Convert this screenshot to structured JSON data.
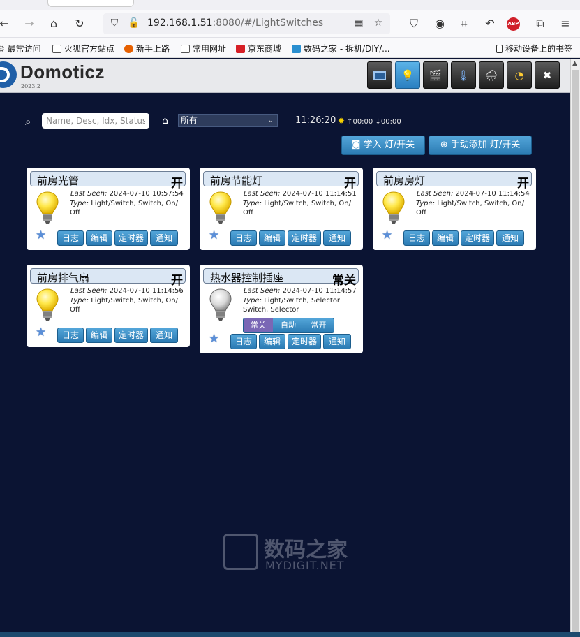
{
  "browser": {
    "url_host": "192.168.1.51",
    "url_rest": ":8080/#/LightSwitches",
    "bookmarks": [
      "最常访问",
      "火狐官方站点",
      "新手上路",
      "常用网址",
      "京东商城",
      "数码之家 - 拆机/DIY/...",
      "移动设备上的书签"
    ]
  },
  "app": {
    "logo_text": "Domoticz",
    "logo_year": "2023.2",
    "nav": [
      {
        "icon": "dashboard-icon",
        "active": false
      },
      {
        "icon": "lightbulb-icon",
        "active": true
      },
      {
        "icon": "scenes-icon",
        "active": false
      },
      {
        "icon": "thermometer-icon",
        "active": false
      },
      {
        "icon": "weather-icon",
        "active": false
      },
      {
        "icon": "utility-icon",
        "active": false
      },
      {
        "icon": "setup-icon",
        "active": false
      }
    ]
  },
  "toolbar": {
    "search_placeholder": "Name, Desc, Idx, Status",
    "room": "所有",
    "time": "11:26:20",
    "sunrise": "00:00",
    "sunset": "00:00",
    "learn_button": "学入 灯/开关",
    "add_button": "手动添加 灯/开关"
  },
  "labels": {
    "last_seen": "Last Seen:",
    "type": "Type:",
    "log": "日志",
    "edit": "编辑",
    "timers": "定时器",
    "notify": "通知"
  },
  "devices": [
    {
      "name": "前房光管",
      "state": "开",
      "last_seen": "2024-07-10 10:57:54",
      "type": "Light/Switch, Switch, On/ Off",
      "bulb_on": true
    },
    {
      "name": "前房节能灯",
      "state": "开",
      "last_seen": "2024-07-10 11:14:51",
      "type": "Light/Switch, Switch, On/ Off",
      "bulb_on": true
    },
    {
      "name": "前房房灯",
      "state": "开",
      "last_seen": "2024-07-10 11:14:54",
      "type": "Light/Switch, Switch, On/ Off",
      "bulb_on": true
    },
    {
      "name": "前房排气扇",
      "state": "开",
      "last_seen": "2024-07-10 11:14:56",
      "type": "Light/Switch, Switch, On/ Off",
      "bulb_on": true
    },
    {
      "name": "热水器控制插座",
      "state": "常关",
      "last_seen": "2024-07-10 11:14:57",
      "type": "Light/Switch, Selector Switch, Selector",
      "bulb_on": false,
      "selector": [
        "常关",
        "自动",
        "常开"
      ],
      "selected": 0
    }
  ],
  "watermark": {
    "cn": "数码之家",
    "en": "MYDIGIT.NET"
  },
  "colors": {
    "background": "#0b1433",
    "button": "#3a8fc8",
    "active_nav": "#4aa5e0",
    "selector_on": "#7a67b5"
  }
}
